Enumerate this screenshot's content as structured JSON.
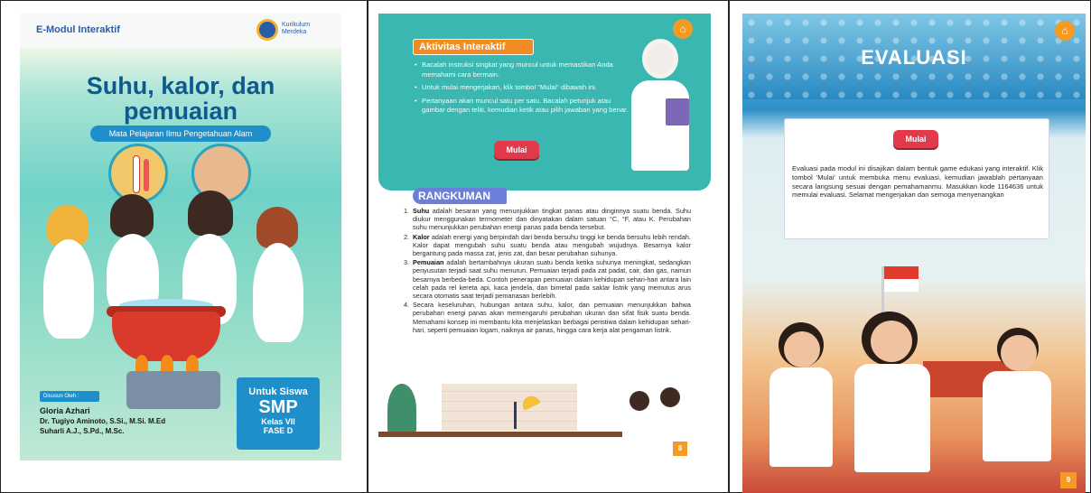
{
  "cover": {
    "brand": "E-Modul Interaktif",
    "curriculum_logo": "Kurikulum Merdeka",
    "title_line1": "Suhu, kalor, dan",
    "title_line2": "pemuaian",
    "subject": "Mata Pelajaran Ilmu Pengetahuan Alam",
    "authors_tag": "Disusun Oleh :",
    "authors": [
      "Gloria Azhari",
      "Dr. Tugiyo Aminoto, S.Si., M.Si. M.Ed",
      "Suharli A.J., S.Pd., M.Sc."
    ],
    "target_label": "Untuk Siswa",
    "level": "SMP",
    "grade": "Kelas VII",
    "phase": "FASE D",
    "accent_color": "#1f8fc9",
    "title_color": "#0e5a8f"
  },
  "activity_page": {
    "home_icon": "home-icon",
    "activity_title": "Aktivitas Interaktif",
    "activity_items": [
      "Bacalah instruksi singkat yang muncul untuk memastikan Anda memahami cara bermain.",
      "Untuk mulai mengerjakan, klik tombol \"Mulai\" dibawah ini.",
      "Pertanyaan akan muncul satu per satu. Bacalah petunjuk atau gambar dengan teliti, kemudian ketik atau pilih jawaban yang benar."
    ],
    "start_button": "Mulai",
    "summary_title": "RANGKUMAN",
    "summary_items": [
      {
        "num": "1.",
        "term": "Suhu",
        "text": " adalah besaran yang menunjukkan tingkat panas atau dinginnya suatu benda. Suhu diukur menggunakan termometer dan dinyatakan dalam satuan °C, °F, atau K. Perubahan suhu menunjukkan perubahan energi panas pada benda tersebut."
      },
      {
        "num": "2.",
        "term": "Kalor",
        "text": " adalah energi yang berpindah dari benda bersuhu tinggi ke benda bersuhu lebih rendah. Kalor dapat mengubah suhu suatu benda atau mengubah wujudnya. Besarnya kalor bergantung pada massa zat, jenis zat, dan besar perubahan suhunya."
      },
      {
        "num": "3.",
        "term": "Pemuaian",
        "text": " adalah bertambahnya ukuran suatu benda ketika suhunya meningkat, sedangkan penyusutan terjadi saat suhu menurun. Pemuaian terjadi pada zat padat, cair, dan gas, namun besarnya berbeda-beda. Contoh penerapan pemuaian dalam kehidupan sehari-hari antara lain celah pada rel kereta api, kaca jendela, dan bimetal pada saklar listrik yang memutus arus secara otomatis saat terjadi pemanasan berlebih."
      },
      {
        "num": "4.",
        "term": "",
        "text": "Secara keseluruhan, hubungan antara suhu, kalor, dan pemuaian menunjukkan bahwa perubahan energi panas akan memengaruhi perubahan ukuran dan sifat fisik suatu benda. Memahami konsep ini membantu kita menjelaskan berbagai peristiwa dalam kehidupan sehari-hari, seperti pemuaian logam, naiknya air panas, hingga cara kerja alat pengaman listrik."
      }
    ],
    "page_number": "8",
    "teal_color": "#3ab7b0",
    "button_color": "#e23a4a"
  },
  "evaluation_page": {
    "home_icon": "home-icon",
    "title": "EVALUASI",
    "start_button": "Mulai",
    "description": "Evaluasi pada modul ini disajikan dalam bentuk game edukasi yang interaktif. Klik tombol 'Mulai' untuk membuka menu evaluasi, kemudian jawablah pertanyaan secara langsung sesuai dengan pemahamanmu. Masukkan kode 1164636 untuk memulai evaluasi. Selamat mengerjakan dan semoga menyenangkan",
    "page_number": "9",
    "header_color": "#2e8fc8"
  }
}
